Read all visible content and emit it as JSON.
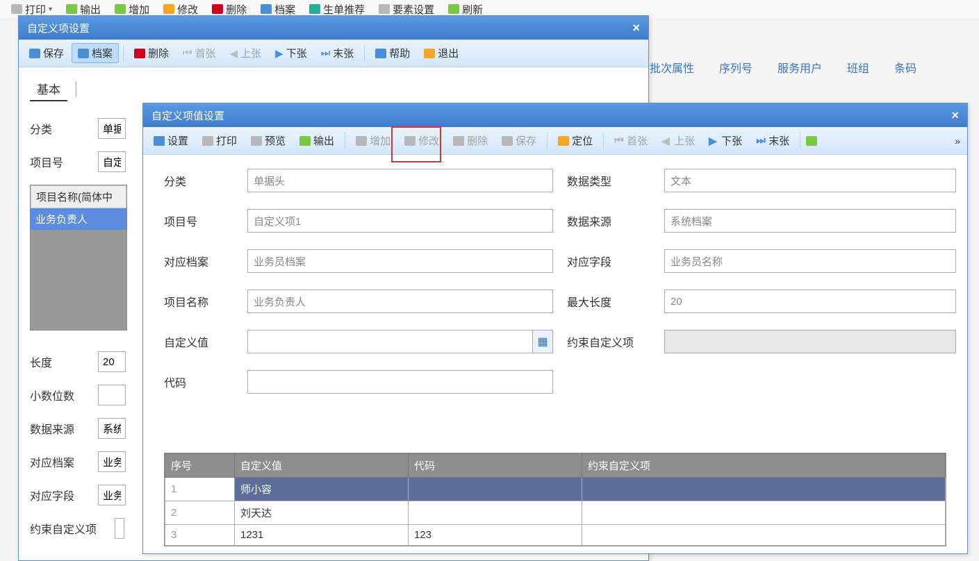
{
  "top_toolbar": {
    "print": "打印",
    "export": "输出",
    "add": "增加",
    "edit": "修改",
    "delete": "删除",
    "archive": "档案",
    "recommend": "生单推荐",
    "config": "要素设置",
    "refresh": "刷新"
  },
  "right_tabs": [
    "批次属性",
    "序列号",
    "服务用户",
    "班组",
    "条码"
  ],
  "dialog1": {
    "title": "自定义项设置",
    "tb": {
      "save": "保存",
      "archive": "档案",
      "delete": "删除",
      "first": "首张",
      "prev": "上张",
      "next": "下张",
      "last": "末张",
      "help": "帮助",
      "exit": "退出"
    },
    "tabs": {
      "basic": "基本"
    },
    "form": {
      "category_label": "分类",
      "category_value": "单据",
      "projno_label": "项目号",
      "projno_value": "自定",
      "list_header": "项目名称(简体中",
      "list_item": "业务负责人",
      "length_label": "长度",
      "length_value": "20",
      "decimal_label": "小数位数",
      "decimal_value": "",
      "datasrc_label": "数据来源",
      "datasrc_value": "系统",
      "file_label": "对应档案",
      "file_value": "业务",
      "field_label": "对应字段",
      "field_value": "业务",
      "constraint_label": "约束自定义项"
    }
  },
  "dialog2": {
    "title": "自定义项值设置",
    "tb": {
      "settings": "设置",
      "print": "打印",
      "preview": "预览",
      "export": "输出",
      "add": "增加",
      "edit": "修改",
      "delete": "删除",
      "save": "保存",
      "locate": "定位",
      "first": "首张",
      "prev": "上张",
      "next": "下张",
      "last": "末张"
    },
    "fields": {
      "category_label": "分类",
      "category_value": "单据头",
      "datatype_label": "数据类型",
      "datatype_value": "文本",
      "projno_label": "项目号",
      "projno_value": "自定义项1",
      "datasrc_label": "数据来源",
      "datasrc_value": "系统档案",
      "file_label": "对应档案",
      "file_value": "业务员档案",
      "field_label": "对应字段",
      "field_value": "业务员名称",
      "name_label": "项目名称",
      "name_value": "业务负责人",
      "maxlen_label": "最大长度",
      "maxlen_value": "20",
      "custval_label": "自定义值",
      "custval_value": "",
      "constraint_label": "约束自定义项",
      "constraint_value": "",
      "code_label": "代码",
      "code_value": ""
    },
    "table": {
      "headers": {
        "seq": "序号",
        "val": "自定义值",
        "code": "代码",
        "constraint": "约束自定义项"
      },
      "rows": [
        {
          "seq": "1",
          "val": "师小容",
          "code": "",
          "constraint": "",
          "selected": true
        },
        {
          "seq": "2",
          "val": "刘天达",
          "code": "",
          "constraint": "",
          "selected": false
        },
        {
          "seq": "3",
          "val": "1231",
          "code": "123",
          "constraint": "",
          "selected": false
        }
      ]
    }
  }
}
